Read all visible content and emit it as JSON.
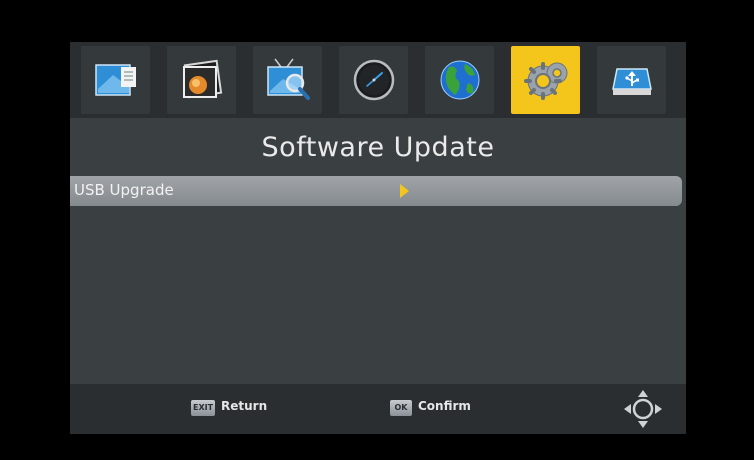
{
  "header": {
    "title": "Software Update"
  },
  "tabs": [
    {
      "icon": "document-icon",
      "active": false
    },
    {
      "icon": "photo-icon",
      "active": false
    },
    {
      "icon": "tv-search-icon",
      "active": false
    },
    {
      "icon": "clock-icon",
      "active": false
    },
    {
      "icon": "globe-icon",
      "active": false
    },
    {
      "icon": "gears-icon",
      "active": true
    },
    {
      "icon": "usb-drive-icon",
      "active": false
    }
  ],
  "menu": {
    "items": [
      {
        "label": "USB Upgrade",
        "selected": true
      }
    ]
  },
  "footer": {
    "exit_key": "EXIT",
    "return_label": "Return",
    "ok_key": "OK",
    "confirm_label": "Confirm",
    "nav_icon": "dpad-icon"
  },
  "colors": {
    "accent": "#f4c51a",
    "panel": "#3a3f42",
    "bar": "#2a2e31",
    "selection": "#9a9ea3"
  }
}
